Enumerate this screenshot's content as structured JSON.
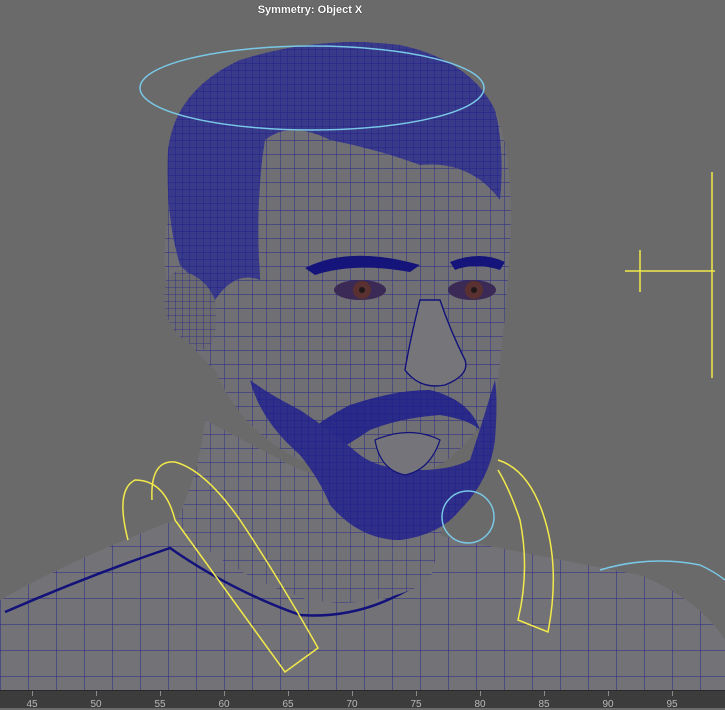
{
  "viewport": {
    "hud_title": "Symmetry: Object X"
  },
  "timeline": {
    "ticks": [
      "45",
      "50",
      "55",
      "60",
      "65",
      "70",
      "75",
      "80",
      "85",
      "90",
      "95"
    ]
  },
  "colors": {
    "viewport_bg": "#6a6a6a",
    "wireframe": "#1b1b8c",
    "nurbs_control_yellow": "#f2ea4a",
    "nurbs_control_cyan": "#79c8e6",
    "mesh_shade": "#6f6f73"
  }
}
